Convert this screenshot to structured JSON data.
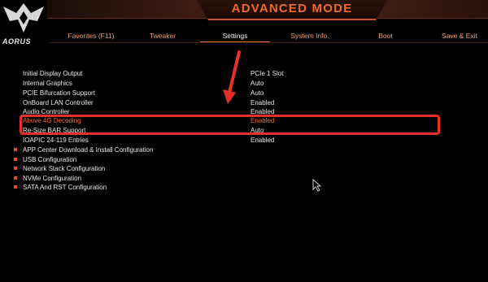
{
  "header": {
    "mode_title": "ADVANCED MODE",
    "logo_text": "AORUS",
    "accent_color": "#f06a28"
  },
  "tabs": [
    {
      "label": "Favorites (F11)",
      "active": false
    },
    {
      "label": "Tweaker",
      "active": false
    },
    {
      "label": "Settings",
      "active": true
    },
    {
      "label": "System Info.",
      "active": false
    },
    {
      "label": "Boot",
      "active": false
    },
    {
      "label": "Save & Exit",
      "active": false
    }
  ],
  "settings": [
    {
      "label": "Initial Display Output",
      "value": "PCIe 1 Slot"
    },
    {
      "label": "Internal Graphics",
      "value": "Auto"
    },
    {
      "label": "PCIE Bifurcation Support",
      "value": "Auto"
    },
    {
      "label": "OnBoard LAN Controller",
      "value": "Enabled"
    },
    {
      "label": "Audio Controller",
      "value": "Enabled"
    },
    {
      "label": "Above 4G Decoding",
      "value": "Enabled",
      "highlighted": true
    },
    {
      "label": "Re-Size BAR Support",
      "value": "Auto"
    },
    {
      "label": "IOAPIC 24-119 Entries",
      "value": "Enabled"
    }
  ],
  "submenus": [
    {
      "label": "APP Center Download & Install Configuration"
    },
    {
      "label": "USB Configuration"
    },
    {
      "label": "Network Stack Configuration"
    },
    {
      "label": "NVMe Configuration"
    },
    {
      "label": "SATA And RST Configuration"
    }
  ],
  "annotation": {
    "box_color": "#e8302a",
    "arrow_color": "#e8302a"
  }
}
